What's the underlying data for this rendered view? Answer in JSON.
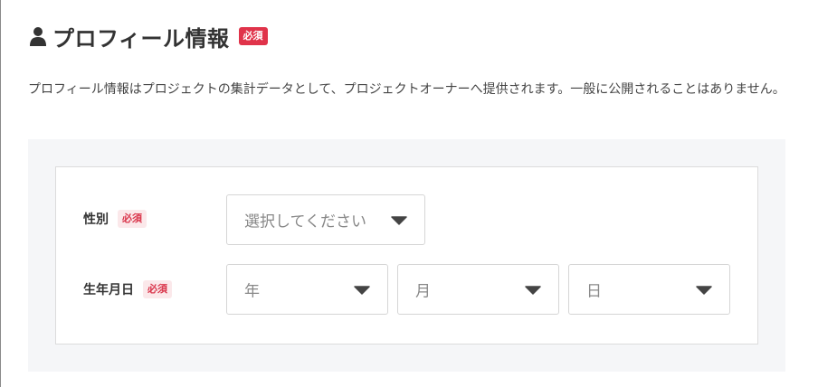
{
  "header": {
    "title": "プロフィール情報",
    "required_badge": "必須"
  },
  "description": "プロフィール情報はプロジェクトの集計データとして、プロジェクトオーナーへ提供されます。一般に公開されることはありません。",
  "form": {
    "gender": {
      "label": "性別",
      "required_badge": "必須",
      "select": {
        "value": "選択してください"
      }
    },
    "birthdate": {
      "label": "生年月日",
      "required_badge": "必須",
      "year": {
        "value": "年"
      },
      "month": {
        "value": "月"
      },
      "day": {
        "value": "日"
      }
    }
  },
  "icons": [
    "person-icon",
    "chevron-down-icon"
  ],
  "colors": {
    "required_badge_bg": "#e0334a",
    "required_badge_soft_bg": "#fbe8ea",
    "panel_bg": "#f5f6f8"
  }
}
